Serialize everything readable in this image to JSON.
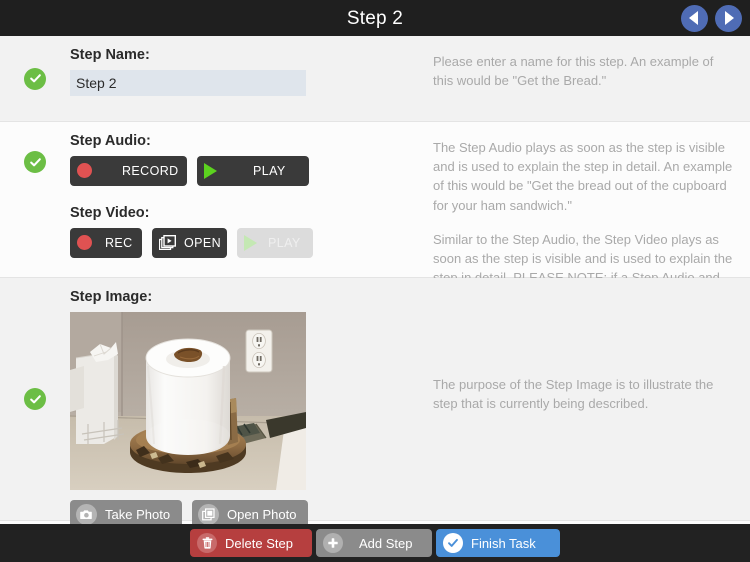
{
  "titlebar": {
    "title": "Step 2",
    "prev_icon": "triangle-left-icon",
    "next_icon": "triangle-right-icon"
  },
  "sections": {
    "step_name": {
      "label": "Step Name:",
      "value": "Step 2",
      "placeholder": "Step Name",
      "status_icon": "check-circle-icon",
      "description": "Please enter a name for this step.  An example of this would be \"Get the Bread.\""
    },
    "step_audio": {
      "label": "Step Audio:",
      "status_icon": "check-circle-icon",
      "record_label": "RECORD",
      "record_icon": "record-dot-icon",
      "play_label": "PLAY",
      "play_icon": "play-triangle-icon",
      "description": "The Step Audio plays as soon as the step is visible and is used to explain the step in detail.  An example of this would be \"Get the bread out of the cupboard for your ham sandwich.\""
    },
    "step_video": {
      "label": "Step Video:",
      "rec_label": "REC",
      "rec_icon": "record-dot-icon",
      "open_label": "OPEN",
      "open_icon": "video-library-icon",
      "play_label": "PLAY",
      "play_icon": "play-triangle-icon",
      "play_disabled": true,
      "description": "Similar to the Step Audio, the Step Video plays as soon as the step is visible and is used to explain the step in detail. PLEASE NOTE: if a Step Audio and Step Video both exist, the Step Video will override the Step Audio."
    },
    "step_image": {
      "label": "Step Image:",
      "status_icon": "check-circle-icon",
      "image_alt": "paper towel roll standing on a wood slice next to a bathroom counter with an electrical outlet",
      "take_photo_label": "Take Photo",
      "take_photo_icon": "camera-icon",
      "open_photo_label": "Open Photo",
      "open_photo_icon": "photo-stack-icon",
      "description": "The purpose of the Step Image is to illustrate the step that is currently being described."
    }
  },
  "bottombar": {
    "delete_label": "Delete Step",
    "delete_icon": "trash-icon",
    "add_label": "Add Step",
    "add_icon": "plus-icon",
    "finish_label": "Finish Task",
    "finish_icon": "check-icon"
  },
  "colors": {
    "titlebar_bg": "#1f1f1f",
    "nav_button": "#4f6cb5",
    "status_green": "#6cbe45",
    "input_bg": "#dfe5ec",
    "media_button_bg": "#3a3a3a",
    "record_red": "#e05252",
    "play_green": "#5cd21f",
    "photo_button_bg": "#8b8b8b",
    "delete_red": "#b63f3f",
    "finish_blue": "#4a90d9",
    "bottombar_bg": "#222222",
    "description_text": "#a9a9a9"
  }
}
